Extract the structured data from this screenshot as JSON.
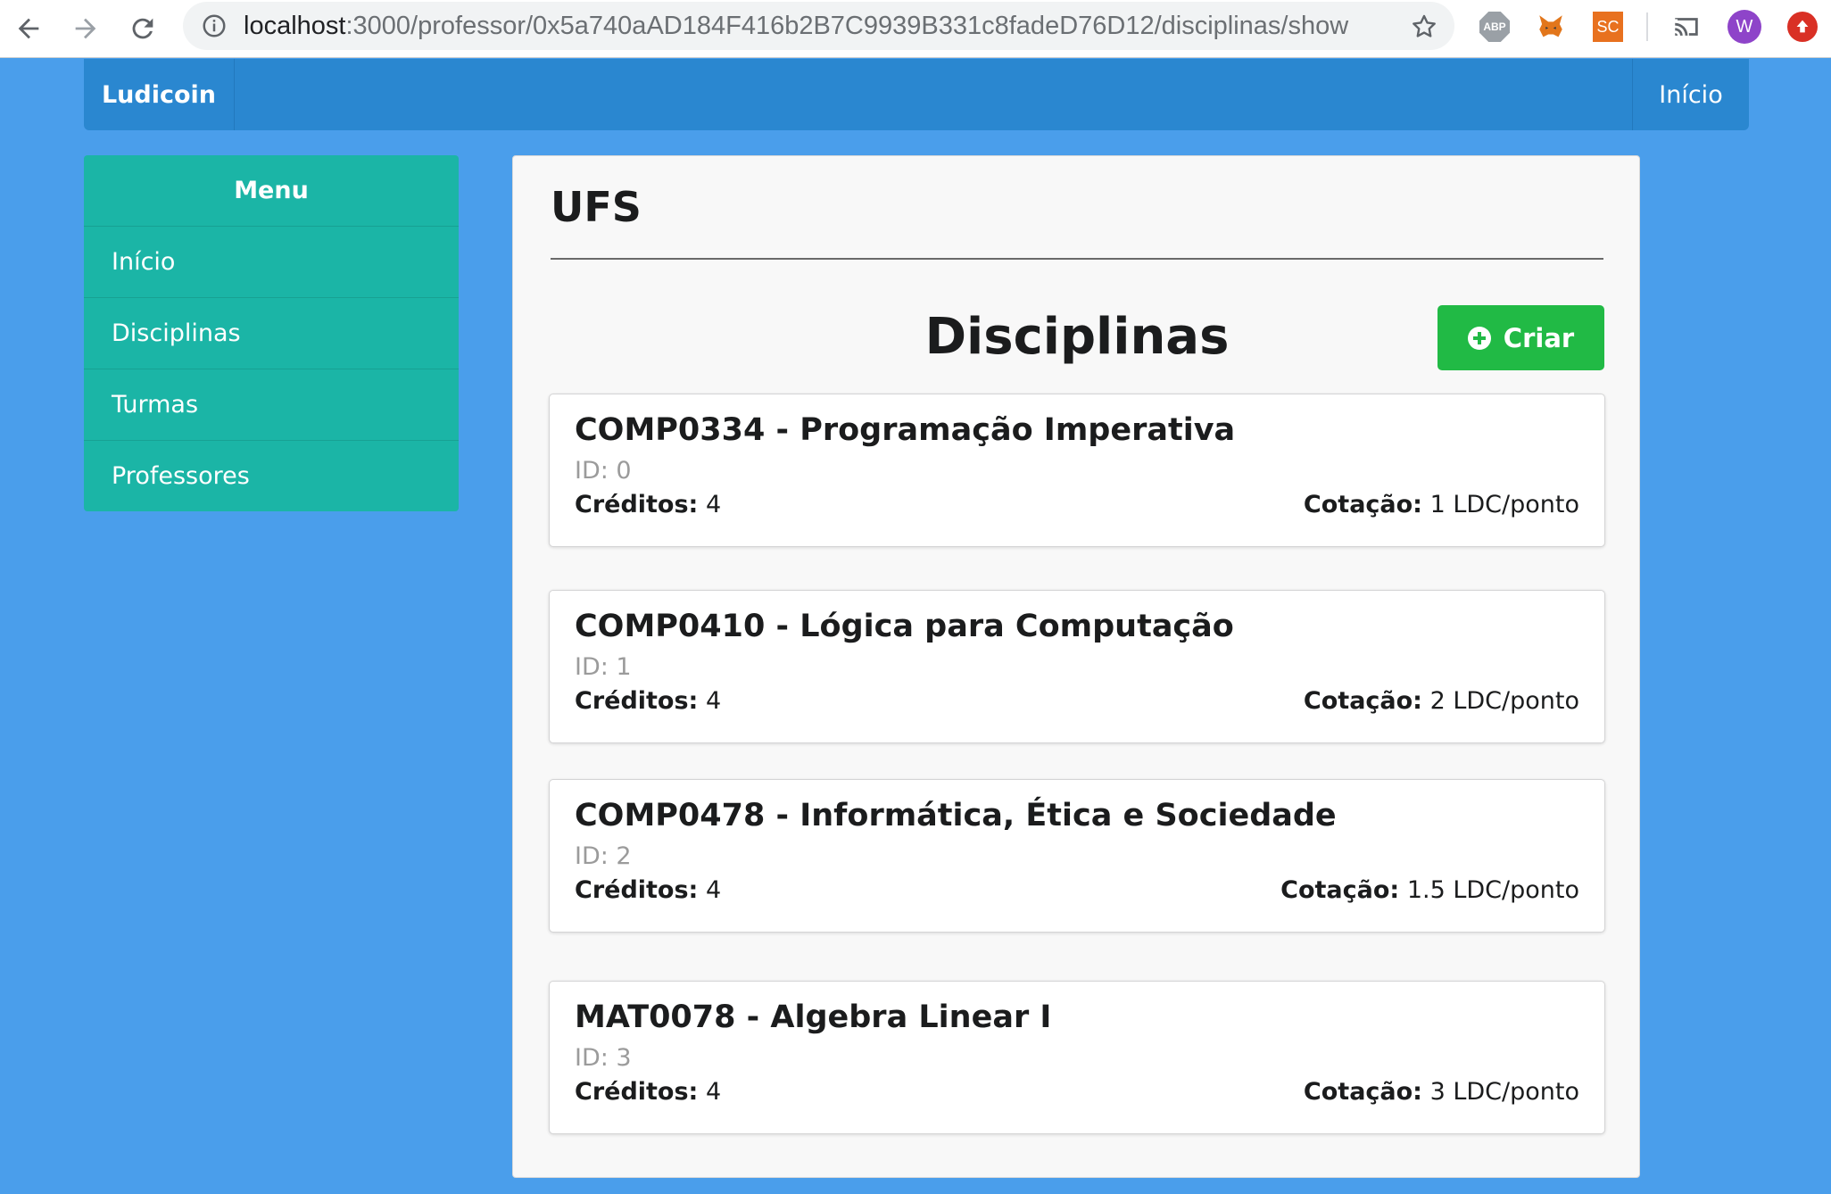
{
  "browser": {
    "url_host": "localhost",
    "url_path": ":3000/professor/0x5a740aAD184F416b2B7C9939B331c8fadeD76D12/disciplinas/show",
    "ext_abp_label": "ABP",
    "ext_sc_label": "SC",
    "profile_initial": "W"
  },
  "topbar": {
    "brand": "Ludicoin",
    "home_link": "Início"
  },
  "menu": {
    "header": "Menu",
    "items": [
      {
        "label": "Início"
      },
      {
        "label": "Disciplinas"
      },
      {
        "label": "Turmas"
      },
      {
        "label": "Professores"
      }
    ]
  },
  "panel": {
    "title": "UFS",
    "section_title": "Disciplinas",
    "create_label": "Criar",
    "credits_label": "Créditos:",
    "rate_label": "Cotação:",
    "courses": [
      {
        "title": "COMP0334 - Programação Imperativa",
        "id": "ID: 0",
        "credits": "4",
        "rate": "1 LDC/ponto"
      },
      {
        "title": "COMP0410 - Lógica para Computação",
        "id": "ID: 1",
        "credits": "4",
        "rate": "2 LDC/ponto"
      },
      {
        "title": "COMP0478 - Informática, Ética e Sociedade",
        "id": "ID: 2",
        "credits": "4",
        "rate": "1.5 LDC/ponto"
      },
      {
        "title": "MAT0078 - Algebra Linear I",
        "id": "ID: 3",
        "credits": "4",
        "rate": "3 LDC/ponto"
      }
    ]
  },
  "colors": {
    "page_bg": "#4a9eeb",
    "topbar": "#2a87d0",
    "menu": "#1bb5a6",
    "create_button": "#21ba45"
  }
}
